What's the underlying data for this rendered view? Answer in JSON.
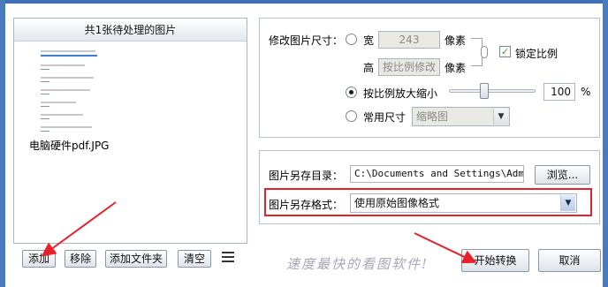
{
  "left_panel": {
    "header": "共1张待处理的图片",
    "thumbnail_caption": "电脑硬件pdf.JPG",
    "buttons": {
      "add": "添加",
      "remove": "移除",
      "add_folder": "添加文件夹",
      "clear": "清空"
    }
  },
  "resize": {
    "label": "修改图片尺寸：",
    "width_label": "宽",
    "width_value": "243",
    "height_label": "高",
    "height_value": "按比例修改",
    "unit": "像素",
    "lock_ratio_label": "锁定比例",
    "lock_ratio_checked": true,
    "scale_label": "按比例放大缩小",
    "scale_value": "100",
    "scale_unit": "%",
    "scale_slider_fraction": 0.4,
    "common_size_label": "常用尺寸",
    "common_size_value": "缩略图",
    "selected_option": "scale"
  },
  "save": {
    "dir_label": "图片另存目录：",
    "dir_value": "C:\\Documents and Settings\\Admini",
    "browse_label": "浏览...",
    "format_label": "图片另存格式：",
    "format_value": "使用原始图像格式"
  },
  "footer": {
    "slogan": "速度最快的看图软件!",
    "start_label": "开始转换",
    "cancel_label": "取消"
  },
  "colors": {
    "highlight": "#e8202a",
    "frame": "#4a7bbd"
  }
}
